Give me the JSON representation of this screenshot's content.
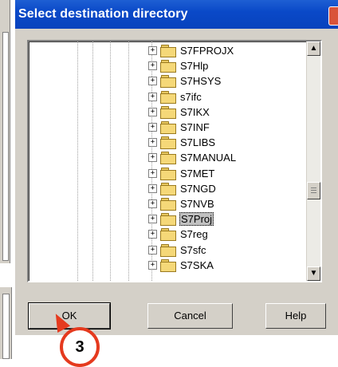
{
  "dialog": {
    "title": "Select destination directory",
    "buttons": {
      "ok": "OK",
      "cancel": "Cancel",
      "help": "Help"
    }
  },
  "tree": {
    "expander_symbol": "+",
    "selected": "S7Proj",
    "items": [
      "S7FPROJX",
      "S7Hlp",
      "S7HSYS",
      "s7ifc",
      "S7IKX",
      "S7INF",
      "S7LIBS",
      "S7MANUAL",
      "S7MET",
      "S7NGD",
      "S7NVB",
      "S7Proj",
      "S7reg",
      "S7sfc",
      "S7SKA"
    ]
  },
  "scrollbar": {
    "up_arrow": "▲",
    "down_arrow": "▼"
  },
  "annotation": {
    "step_number": "3"
  },
  "colors": {
    "titlebar": "#0a49c8",
    "annotation": "#e53a1e",
    "folder": "#f5d878"
  }
}
